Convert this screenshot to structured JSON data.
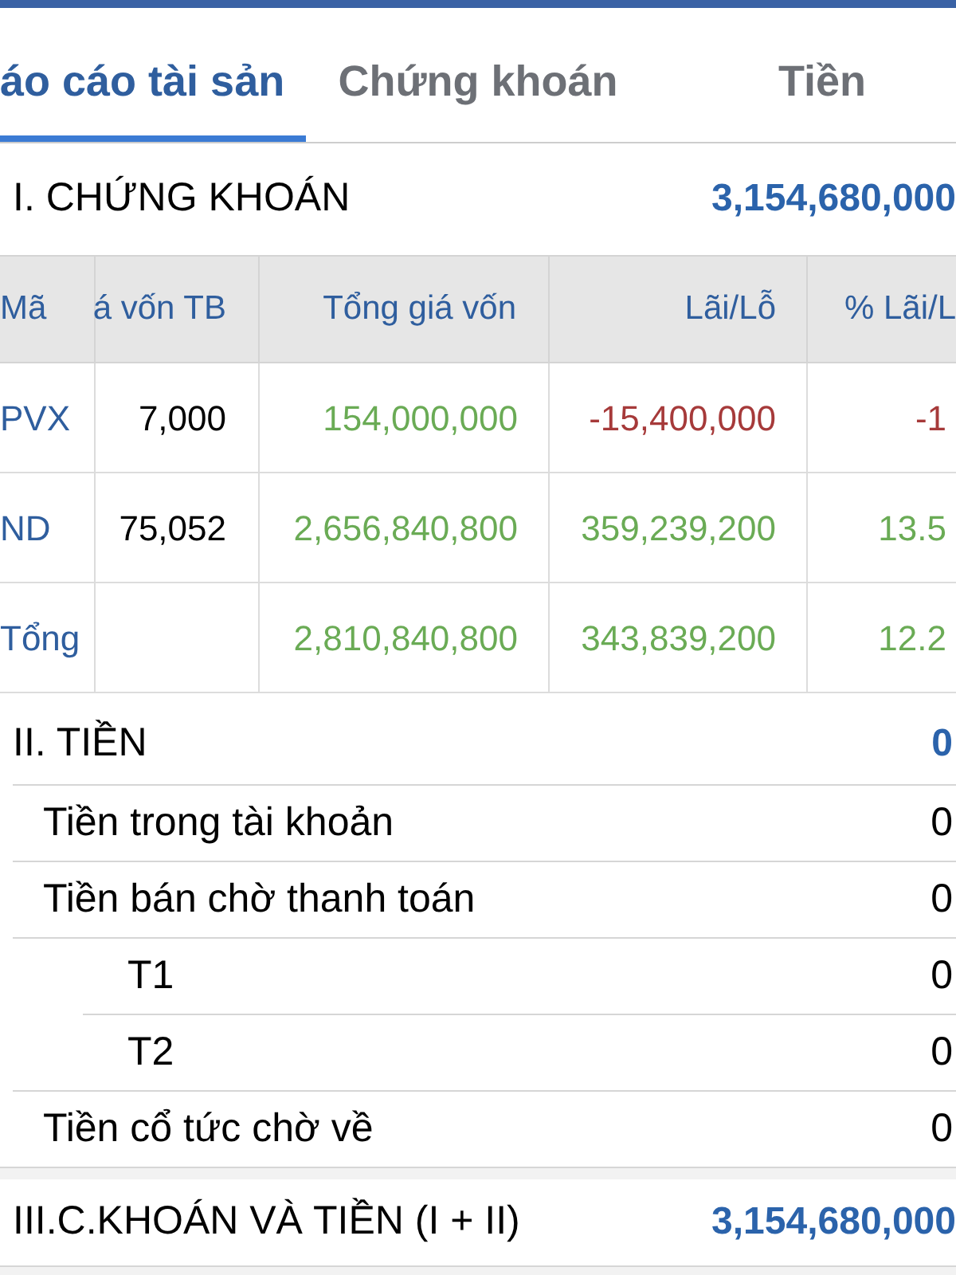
{
  "tabs": [
    {
      "label": "áo cáo tài sản",
      "selected": true
    },
    {
      "label": "Chứng khoán",
      "selected": false
    },
    {
      "label": "Tiền",
      "selected": false
    }
  ],
  "securities_section": {
    "title": "I. CHỨNG KHOÁN",
    "value": "3,154,680,000"
  },
  "table": {
    "columns": [
      "Mã",
      "á vốn TB",
      "Tổng giá vốn",
      "Lãi/Lỗ",
      "% Lãi/L"
    ],
    "rows": [
      {
        "code": "PVX",
        "avg_cost": "7,000",
        "total_cost": "154,000,000",
        "profit": "-15,400,000",
        "profit_pct": "-1",
        "loss": true
      },
      {
        "code": "ND",
        "avg_cost": "75,052",
        "total_cost": "2,656,840,800",
        "profit": "359,239,200",
        "profit_pct": "13.5",
        "loss": false
      },
      {
        "code": "Tổng",
        "total_cost": "2,810,840,800",
        "profit": "343,839,200",
        "profit_pct": "12.2",
        "loss": false
      }
    ]
  },
  "cash_section": {
    "title": "II. TIỀN",
    "value": "0",
    "items": [
      {
        "label": "Tiền trong tài khoản",
        "value": "0"
      },
      {
        "label": "Tiền bán chờ thanh toán",
        "value": "0",
        "children": [
          {
            "label": "T1",
            "value": "0"
          },
          {
            "label": "T2",
            "value": "0"
          }
        ]
      },
      {
        "label": "Tiền cổ tức chờ về",
        "value": "0"
      }
    ]
  },
  "total_section": {
    "title": "III.C.KHOÁN VÀ TIỀN (I + II)",
    "value": "3,154,680,000"
  }
}
